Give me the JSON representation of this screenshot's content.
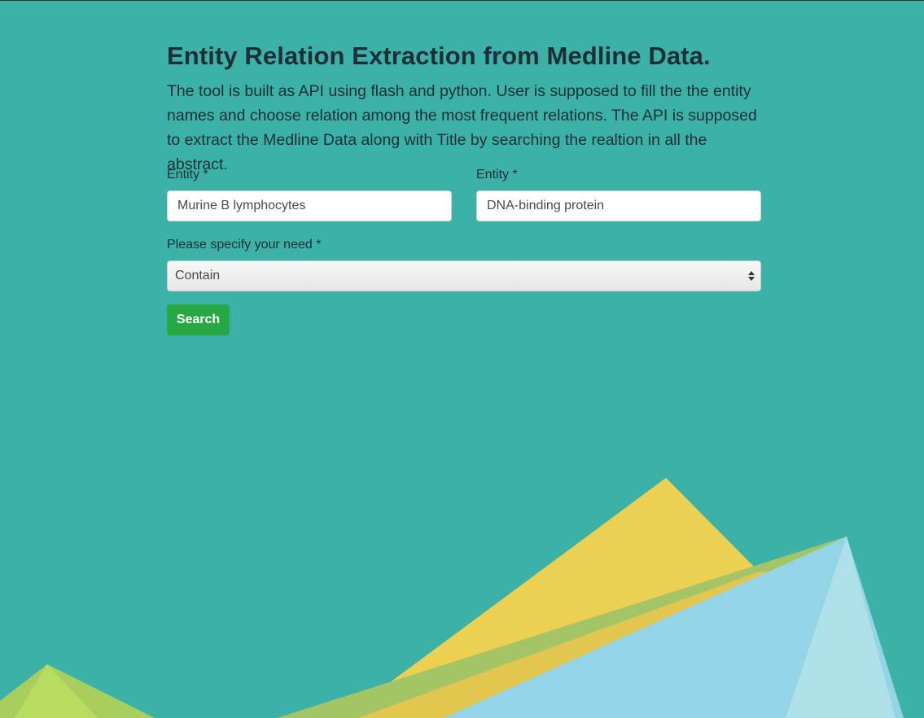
{
  "header": {
    "title": "Entity Relation Extraction from Medline Data.",
    "description": "The tool is built as API using flash and python. User is supposed to fill the the entity names and choose relation among the most frequent relations. The API is supposed to extract the Medline Data along with Title by searching the realtion in all the abstract."
  },
  "form": {
    "entity1": {
      "label": "Entity *",
      "value": "Murine B lymphocytes"
    },
    "entity2": {
      "label": "Entity *",
      "value": "DNA-binding protein"
    },
    "relation": {
      "label": "Please specify your need *",
      "selected": "Contain"
    },
    "search_label": "Search"
  },
  "colors": {
    "background": "#3bb1a7",
    "button": "#28a745",
    "shape_yellow": "#ecd052",
    "shape_blue": "#93d4e6",
    "shape_green": "#b6da5f"
  }
}
